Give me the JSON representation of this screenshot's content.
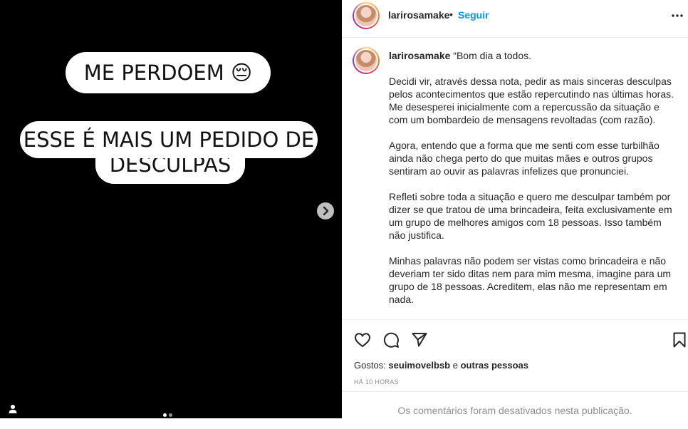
{
  "media": {
    "line1": "ME PERDOEM 😔",
    "line2": "ESSE É MAIS UM PEDIDO DE",
    "line3": "DESCULPAS",
    "next_icon": "chevron-right-icon",
    "tag_icon": "person-icon",
    "slides": 2,
    "active_slide": 1
  },
  "header": {
    "username": "larirosamake",
    "separator": "•",
    "follow_label": "Seguir",
    "more_icon": "more-horizontal-icon"
  },
  "caption": {
    "username": "larirosamake",
    "p1": "“Bom dia a todos.",
    "p2": "Decidi vir, através dessa nota, pedir as mais sinceras desculpas pelos acontecimentos que estão repercutindo nas últimas horas. Me desesperei inicialmente com a repercussão da situação e com um bombardeio de mensagens revoltadas (com razão).",
    "p3": "Agora, entendo que a forma que me senti com esse turbilhão ainda não chega perto do que muitas mães e outros grupos sentiram ao ouvir as palavras infelizes que pronunciei.",
    "p4": "Refleti sobre toda a situação e quero me desculpar também por dizer se que tratou de uma brincadeira, feita exclusivamente em um grupo de melhores amigos com 18 pessoas. Isso também não justifica.",
    "p5": "Minhas palavras não podem ser vistas como brincadeira e não deveriam ter sido ditas nem para mim mesma, imagine para um grupo de 18 pessoas. Acreditem, elas não me representam em nada."
  },
  "actions": {
    "like_icon": "heart-icon",
    "comment_icon": "comment-icon",
    "share_icon": "send-icon",
    "save_icon": "bookmark-icon",
    "likes_prefix": "Gostos:",
    "likes_user": "seuimovelbsb",
    "likes_and": "e",
    "likes_others": "outras pessoas",
    "time": "HÁ 10 HORAS",
    "comments_disabled": "Os comentários foram desativados nesta publicação."
  },
  "colors": {
    "accent": "#0095f6",
    "text": "#262626",
    "muted": "#8e8e8e"
  }
}
